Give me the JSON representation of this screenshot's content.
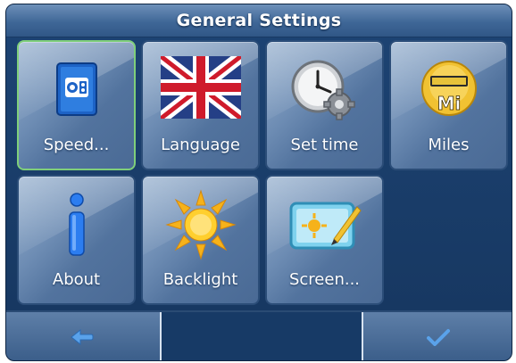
{
  "header": {
    "title": "General Settings"
  },
  "tiles": [
    {
      "label": "Speed...",
      "icon": "speed-camera-icon",
      "selected": true
    },
    {
      "label": "Language",
      "icon": "uk-flag-icon"
    },
    {
      "label": "Set time",
      "icon": "clock-gear-icon"
    },
    {
      "label": "Miles",
      "icon": "odometer-miles-icon",
      "icon_text": "Mi"
    },
    {
      "label": "About",
      "icon": "info-icon"
    },
    {
      "label": "Backlight",
      "icon": "sun-icon"
    },
    {
      "label": "Screen...",
      "icon": "screen-calibrate-icon"
    }
  ],
  "bottom_bar": {
    "back_icon": "back-arrow-icon",
    "confirm_icon": "checkmark-icon"
  },
  "colors": {
    "background": "#1d4474",
    "tile": "#6e8db4",
    "selected_border": "#7fcf7a"
  }
}
